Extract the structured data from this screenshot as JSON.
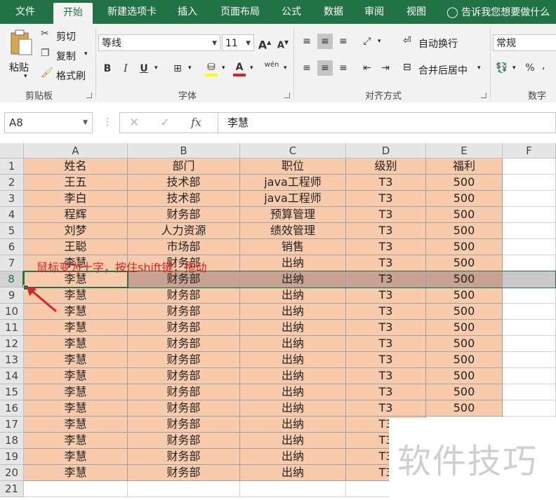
{
  "tabs": [
    "文件",
    "开始",
    "新建选项卡",
    "插入",
    "页面布局",
    "公式",
    "数据",
    "审阅",
    "视图"
  ],
  "tell_me": "告诉我您想要做什么",
  "clipboard": {
    "paste": "粘贴",
    "cut": "剪切",
    "copy": "复制",
    "painter": "格式刷",
    "group": "剪贴板"
  },
  "font": {
    "name": "等线",
    "size": "11",
    "group": "字体",
    "bold": "B",
    "italic": "I",
    "underline": "U",
    "grow": "A",
    "shrink": "A",
    "color_a": "A",
    "wen": "wén"
  },
  "align": {
    "wrap": "自动换行",
    "merge": "合并后居中",
    "group": "对齐方式"
  },
  "number": {
    "format": "常规",
    "group": "数字",
    "percent": "%"
  },
  "formula_bar": {
    "name_box": "A8",
    "fx": "fx",
    "cancel": "✕",
    "enter": "✓",
    "formula": "李慧"
  },
  "columns": [
    "A",
    "B",
    "C",
    "D",
    "E",
    "F"
  ],
  "rows": [
    [
      "姓名",
      "部门",
      "职位",
      "级别",
      "福利"
    ],
    [
      "王五",
      "技术部",
      "java工程师",
      "T3",
      "500"
    ],
    [
      "李白",
      "技术部",
      "java工程师",
      "T3",
      "500"
    ],
    [
      "程辉",
      "财务部",
      "预算管理",
      "T3",
      "500"
    ],
    [
      "刘梦",
      "人力资源",
      "绩效管理",
      "T3",
      "500"
    ],
    [
      "王聪",
      "市场部",
      "销售",
      "T3",
      "500"
    ],
    [
      "李慧",
      "财务部",
      "出纳",
      "T3",
      "500"
    ],
    [
      "李慧",
      "财务部",
      "出纳",
      "T3",
      "500"
    ],
    [
      "李慧",
      "财务部",
      "出纳",
      "T3",
      "500"
    ],
    [
      "李慧",
      "财务部",
      "出纳",
      "T3",
      "500"
    ],
    [
      "李慧",
      "财务部",
      "出纳",
      "T3",
      "500"
    ],
    [
      "李慧",
      "财务部",
      "出纳",
      "T3",
      "500"
    ],
    [
      "李慧",
      "财务部",
      "出纳",
      "T3",
      "500"
    ],
    [
      "李慧",
      "财务部",
      "出纳",
      "T3",
      "500"
    ],
    [
      "李慧",
      "财务部",
      "出纳",
      "T3",
      "500"
    ],
    [
      "李慧",
      "财务部",
      "出纳",
      "T3",
      "500"
    ],
    [
      "李慧",
      "财务部",
      "出纳",
      "T3",
      ""
    ],
    [
      "李慧",
      "财务部",
      "出纳",
      "T3",
      ""
    ],
    [
      "李慧",
      "财务部",
      "出纳",
      "T3",
      ""
    ],
    [
      "李慧",
      "财务部",
      "出纳",
      "T3",
      ""
    ],
    [
      "",
      "",
      "",
      "",
      ""
    ]
  ],
  "annotation": "鼠标变为十字，按住shift键，拖动",
  "watermark": "软件技巧",
  "colors": {
    "ribbon_green": "#217346",
    "fill": "#f8cbad",
    "annotation": "#e02020"
  }
}
